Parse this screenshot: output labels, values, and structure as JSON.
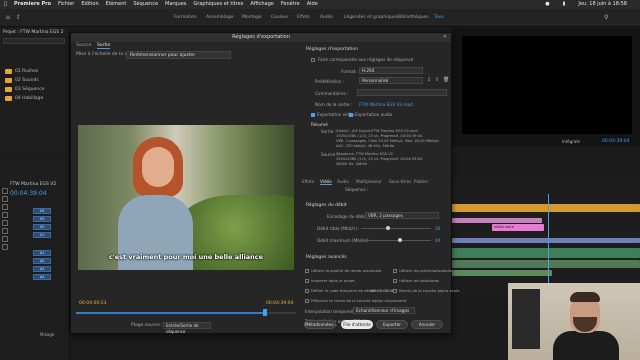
{
  "menubar": {
    "app": "Premiere Pro",
    "items": [
      "Fichier",
      "Edition",
      "Elément",
      "Séquence",
      "Marques",
      "Graphiques et titres",
      "Affichage",
      "Fenêtre",
      "Aide"
    ],
    "clock": "Jeu. 18 juin à 18:58"
  },
  "workspaces": [
    "Formation",
    "Assemblage",
    "Montage",
    "Couleur",
    "Effets",
    "Audio",
    "Légendes et graphiques",
    "Bibliothèques",
    "Tous"
  ],
  "active_workspace": "Tous",
  "project": {
    "title": "Projet : FTW Martina EGS 2",
    "folders": [
      "01 Rushes",
      "02 Sounds",
      "03 Séquence",
      "04 Habillage"
    ]
  },
  "left_timeline": {
    "sequence": "FTW Martina EGS V2",
    "timecode": "00:04:39:04",
    "tracks": [
      "V4",
      "V3",
      "V2",
      "V1",
      "A1",
      "A2",
      "A3",
      "A4"
    ],
    "mixage": "Mixage"
  },
  "dialog": {
    "title": "Réglages d'exportation",
    "tabs": [
      "Source",
      "Sortie"
    ],
    "active_tab": "Sortie",
    "source_scale_label": "Mise à l'échelle de la source :",
    "source_scale_value": "Redimensionner pour ajuster",
    "subtitle": "c'est vraiment pour moi une belle alliance",
    "tc_in": "00:04:00:23",
    "tc_out": "00:04:39:04",
    "range_label": "Plage source :",
    "range_value": "Entrée/Sortie de séquence",
    "export_settings": {
      "header": "Réglages d'exportation",
      "match_sequence": "Faire correspondre aux réglages de séquence",
      "format_label": "Format :",
      "format_value": "H.264",
      "preset_label": "Prédéfinition :",
      "preset_value": "Personnalisé",
      "comments_label": "Commentaires :",
      "output_label": "Nom de la sortie :",
      "output_value": "FTW Martina EGS V2.mp4",
      "export_video": "Exportation vidéo",
      "export_audio": "Exportation audio",
      "summary_header": "Résumé",
      "summary_output_label": "Sortie :",
      "summary_output": "/Users/.../04 Export/FTW Martina EGS V2.mp4",
      "summary_output_line2": "1920x1080 (1,0), 25 i/s, Progressif, 00:04:39:04",
      "summary_output_line3": "VBR, 2 passages, Cible 20,00 Mbits/s, Max. 40,00 Mbits/s",
      "summary_output_line4": "AAC, 320 kbits/s, 48 kHz, Stéréo",
      "summary_source_label": "Source :",
      "summary_source": "Séquence, FTW Martina EGS V2",
      "summary_source_line2": "1920x1080 (1,0), 25 i/s, Progressif, 00:04:39:04",
      "summary_source_line3": "48000 Hz, Stéréo"
    },
    "settings_tabs": [
      "Effets",
      "Vidéo",
      "Audio",
      "Multiplexeur",
      "Sous-titres",
      "Publier"
    ],
    "active_settings_tab": "Vidéo",
    "sequence_label": "Séquence :",
    "bitrate": {
      "header": "Réglages du débit",
      "encoding_label": "Encodage du débit :",
      "encoding_value": "VBR, 2 passages",
      "target_label": "Débit cible [Mbit/s] :",
      "target_value": "20",
      "max_label": "Débit maximum [Mbit/s] :",
      "max_value": "40",
      "target_fraction": 0.38,
      "max_fraction": 0.55
    },
    "advanced": {
      "header": "Réglages avancés",
      "options_left": [
        "Utiliser la qualité de rendu maximale",
        "Importer dans le projet",
        "Définir le code temporel de début",
        "Effectuer le rendu de la couche alpha uniquement"
      ],
      "start_timecode": "00:00:00:00",
      "options_right": [
        "Utiliser les prévisualisations",
        "Utiliser les doublures",
        "Rendu de la couche alpha seule"
      ],
      "interpolation_label": "Interpolation temporelle :",
      "interpolation_value": "Echantillonneur d'images",
      "filesize_label": "Taille de fichier estimée :",
      "filesize_value": "709 Mo"
    },
    "buttons": {
      "metadata": "Métadonnées...",
      "queue": "File d'attente",
      "export": "Exporter",
      "cancel": "Annuler"
    }
  },
  "program_monitor": {
    "fit": "Intégrale",
    "timecode": "00:04:39:04"
  },
  "right_timeline": {
    "clip_label": "Vidéo noire"
  }
}
